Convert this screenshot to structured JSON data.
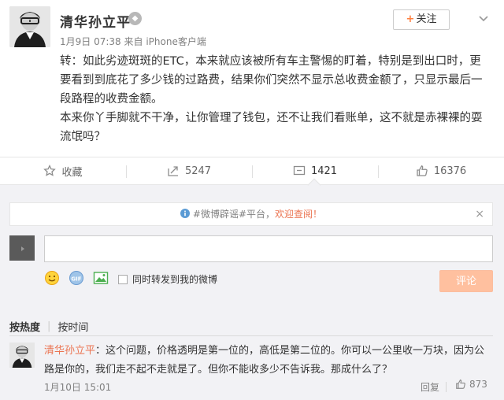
{
  "post": {
    "author": "清华孙立平",
    "follow_label": "关注",
    "follow_plus": "+",
    "menu_icon": "chevron-down-icon",
    "time": "1月9日 07:38",
    "source_prefix": "来自",
    "source": "iPhone客户端",
    "paragraph_1": "转：如此劣迹斑斑的ETC，本来就应该被所有车主警惕的盯着，特别是到出口时，更要看到到底花了多少钱的过路费，结果你们突然不显示总收费金额了，只显示最后一段路程的收费金额。",
    "paragraph_2": "本来你丫手脚就不干净，让你管理了钱包，还不让我们看账单，这不就是赤裸裸的耍流氓吗？"
  },
  "actions": {
    "favorite_label": "收藏",
    "repost_count": "5247",
    "comment_count": "1421",
    "like_count": "16376"
  },
  "comment_box": {
    "notice_prefix": "#微博辟谣#平台，",
    "notice_link": "欢迎查阅！",
    "notice_close": "×",
    "input_value": "",
    "repost_option": "同时转发到我的微博",
    "submit_label": "评论"
  },
  "sort": {
    "hot": "按热度",
    "sep": "|",
    "time": "按时间"
  },
  "comments": [
    {
      "user": "清华孙立平",
      "text": "：这个问题，价格透明是第一位的，高低是第二位的。你可以一公里收一万块，因为公路是你的，我们走不起不走就是了。但你不能收多少不告诉我。那成什么了？",
      "time": "1月10日 15:01",
      "reply_label": "回复",
      "like_count": "873"
    }
  ],
  "colors": {
    "accent": "#eb7350",
    "follow_plus": "#ff8140",
    "panel_bg": "#f2f2f5",
    "submit_disabled": "#ffc09f"
  }
}
